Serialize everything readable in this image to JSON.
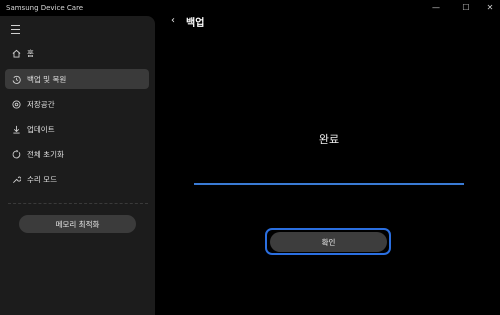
{
  "window": {
    "title": "Samsung Device Care",
    "controls": {
      "minimize": "—",
      "maximize": "☐",
      "close": "✕"
    }
  },
  "sidebar": {
    "items": [
      {
        "label": "홈",
        "icon": "home-icon"
      },
      {
        "label": "백업 및 복원",
        "icon": "backup-restore-icon",
        "active": true
      },
      {
        "label": "저장공간",
        "icon": "storage-icon"
      },
      {
        "label": "업데이트",
        "icon": "download-icon"
      },
      {
        "label": "전체 초기화",
        "icon": "reset-icon"
      },
      {
        "label": "수리 모드",
        "icon": "wrench-icon"
      }
    ],
    "memory_button": "메모리 최적화"
  },
  "main": {
    "back_icon": "‹",
    "title": "백업",
    "status": "완료",
    "progress": 1.0,
    "ok_button": "확인"
  },
  "colors": {
    "accent": "#3a7bd5",
    "focus_ring": "#2b6fe0",
    "sidebar_bg": "#1c1c1c"
  }
}
